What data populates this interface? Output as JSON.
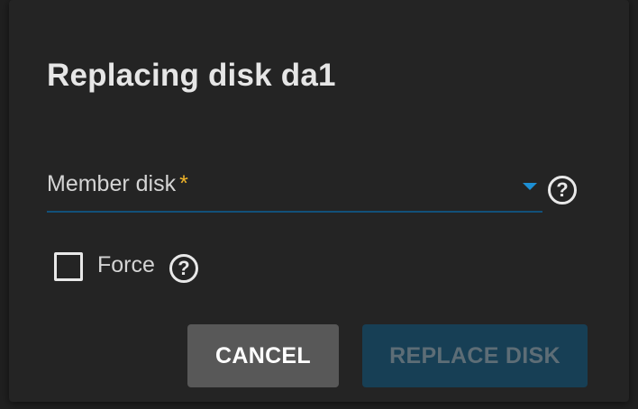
{
  "dialog": {
    "title": "Replacing disk da1",
    "member_disk": {
      "label": "Member disk",
      "required_marker": "*",
      "value": ""
    },
    "force": {
      "label": "Force",
      "checked": false
    },
    "help_glyph": "?",
    "buttons": {
      "cancel": "CANCEL",
      "replace": "REPLACE DISK"
    }
  },
  "colors": {
    "dialog_background": "#242424",
    "accent_blue": "#1d8fd4",
    "required_marker": "#f0b429",
    "cancel_button": "#585858",
    "replace_button_disabled": "#173f55"
  },
  "icons": [
    "dropdown-arrow-icon",
    "help-icon",
    "checkbox-icon"
  ]
}
